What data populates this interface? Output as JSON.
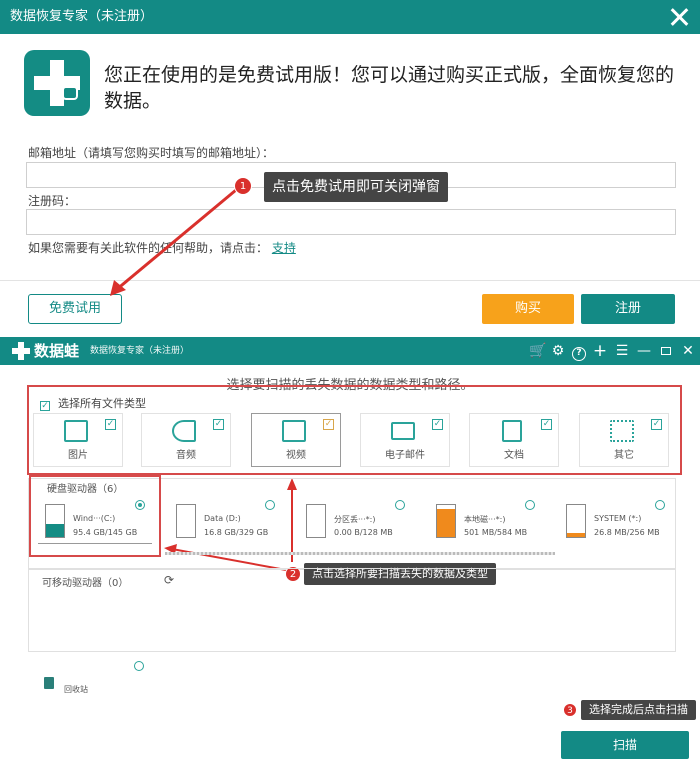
{
  "dialog": {
    "title": "数据恢复专家（未注册）",
    "headline": "您正在使用的是免费试用版！您可以通过购买正式版，全面恢复您的数据。",
    "email_label": "邮箱地址（请填写您购买时填写的邮箱地址）：",
    "email_value": "",
    "code_label": "注册码：",
    "code_value": "",
    "help_text": "如果您需要有关此软件的任何帮助，请点击：",
    "help_link": "支持",
    "trial_button": "免费试用",
    "buy_button": "购买",
    "register_button": "注册"
  },
  "callouts": [
    {
      "num": "1",
      "text": "点击免费试用即可关闭弹窗"
    },
    {
      "num": "2",
      "text": "点击选择所要扫描丢失的数据及类型"
    },
    {
      "num": "3",
      "text": "选择完成后点击扫描"
    }
  ],
  "app": {
    "brand": "数据蛙",
    "title": "数据恢复专家（未注册）",
    "toolbar_icons": [
      "cart-icon",
      "settings-icon",
      "help-icon",
      "plus-icon",
      "menu-icon",
      "minimize-icon",
      "maximize-icon",
      "close-icon"
    ],
    "scan_tip": "选择要扫描的丢失数据的数据类型和路径。",
    "select_all": "选择所有文件类型",
    "file_types": [
      {
        "label": "图片",
        "icon": "image-icon",
        "checked": true
      },
      {
        "label": "音频",
        "icon": "audio-icon",
        "checked": true
      },
      {
        "label": "视频",
        "icon": "video-icon",
        "checked": true
      },
      {
        "label": "电子邮件",
        "icon": "email-icon",
        "checked": true
      },
      {
        "label": "文档",
        "icon": "document-icon",
        "checked": true
      },
      {
        "label": "其它",
        "icon": "other-icon",
        "checked": true
      }
    ],
    "drives_label": "硬盘驱动器（6）",
    "drives": [
      {
        "name": "Wind···(C:)",
        "size": "95.4 GB/145 GB",
        "used_fraction": 0.4,
        "selected": true
      },
      {
        "name": "Data (D:)",
        "size": "16.8 GB/329 GB",
        "used_fraction": 0.0,
        "selected": false
      },
      {
        "name": "分区丢···*:)",
        "size": "0.00  B/128 MB",
        "used_fraction": 0.0,
        "selected": false
      },
      {
        "name": "本地磁···*:)",
        "size": "501 MB/584 MB",
        "used_fraction": 0.86,
        "selected": false
      },
      {
        "name": "SYSTEM (*:)",
        "size": "26.8 MB/256 MB",
        "used_fraction": 0.12,
        "selected": false
      }
    ],
    "removable_label": "可移动驱动器（0）",
    "recycle_label": "回收站",
    "scan_button": "扫描"
  }
}
